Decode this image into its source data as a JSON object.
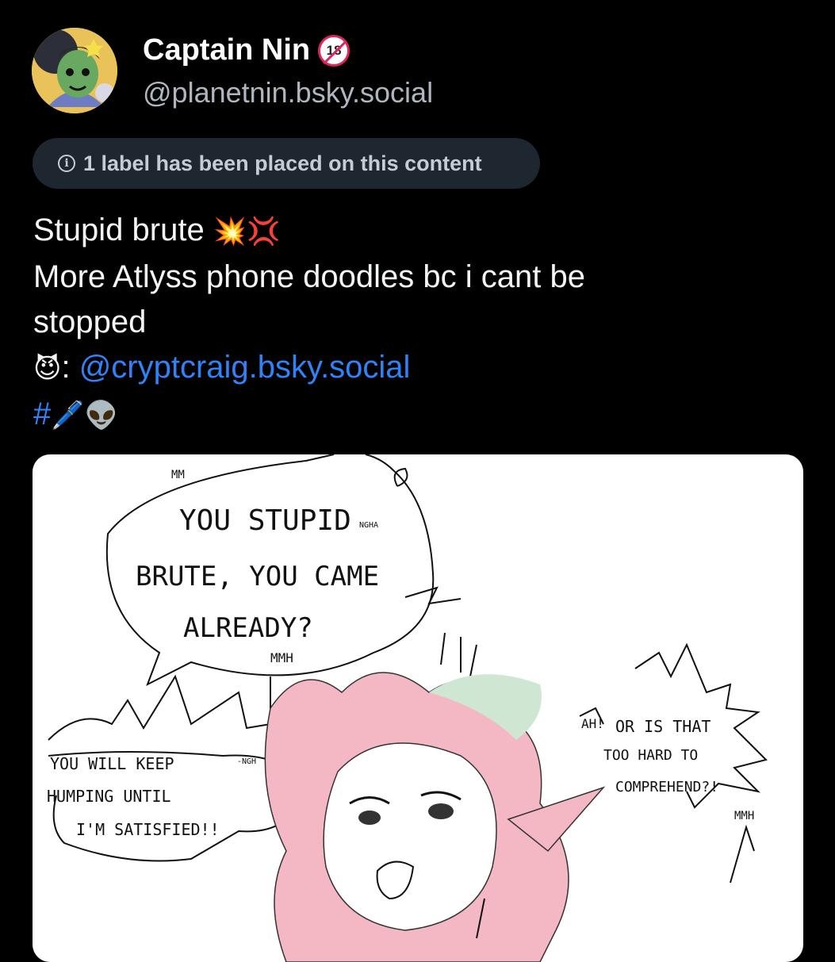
{
  "author": {
    "display_name": "Captain Nin",
    "handle": "@planetnin.bsky.social",
    "badge": "18",
    "badge_icon": "adult-content-icon"
  },
  "moderation": {
    "label_text": "1 label has been placed on this content",
    "icon": "info-icon"
  },
  "post": {
    "line1_text": "Stupid brute ",
    "line1_emoji": "💥💢",
    "line2": "More Atlyss phone doodles bc i cant be",
    "line3": "stopped",
    "mention_emoji": "😈",
    "mention_sep": ": ",
    "mention": "@cryptcraig.bsky.social",
    "hashtag_prefix": "#",
    "hashtag_emoji": "🖊️👽"
  },
  "image": {
    "speech_bubble_1_line1": "YOU STUPID",
    "speech_bubble_1_small": "NGHA",
    "speech_bubble_1_line2": "BRUTE, YOU CAME",
    "speech_bubble_1_line3": "ALREADY?",
    "speech_bubble_1_top": "MM",
    "speech_bubble_1_sfx": "MMH",
    "speech_left_line1": "YOU WILL KEEP",
    "speech_left_small": "-NGH",
    "speech_left_line2": "HUMPING UNTIL",
    "speech_left_line3": "I'M SATISFIED!!",
    "speech_right_ah": "AH!",
    "speech_right_line1": "OR IS THAT",
    "speech_right_line2": "TOO HARD TO",
    "speech_right_line3": "COMPREHEND?!",
    "speech_right_sfx": "MMH"
  }
}
